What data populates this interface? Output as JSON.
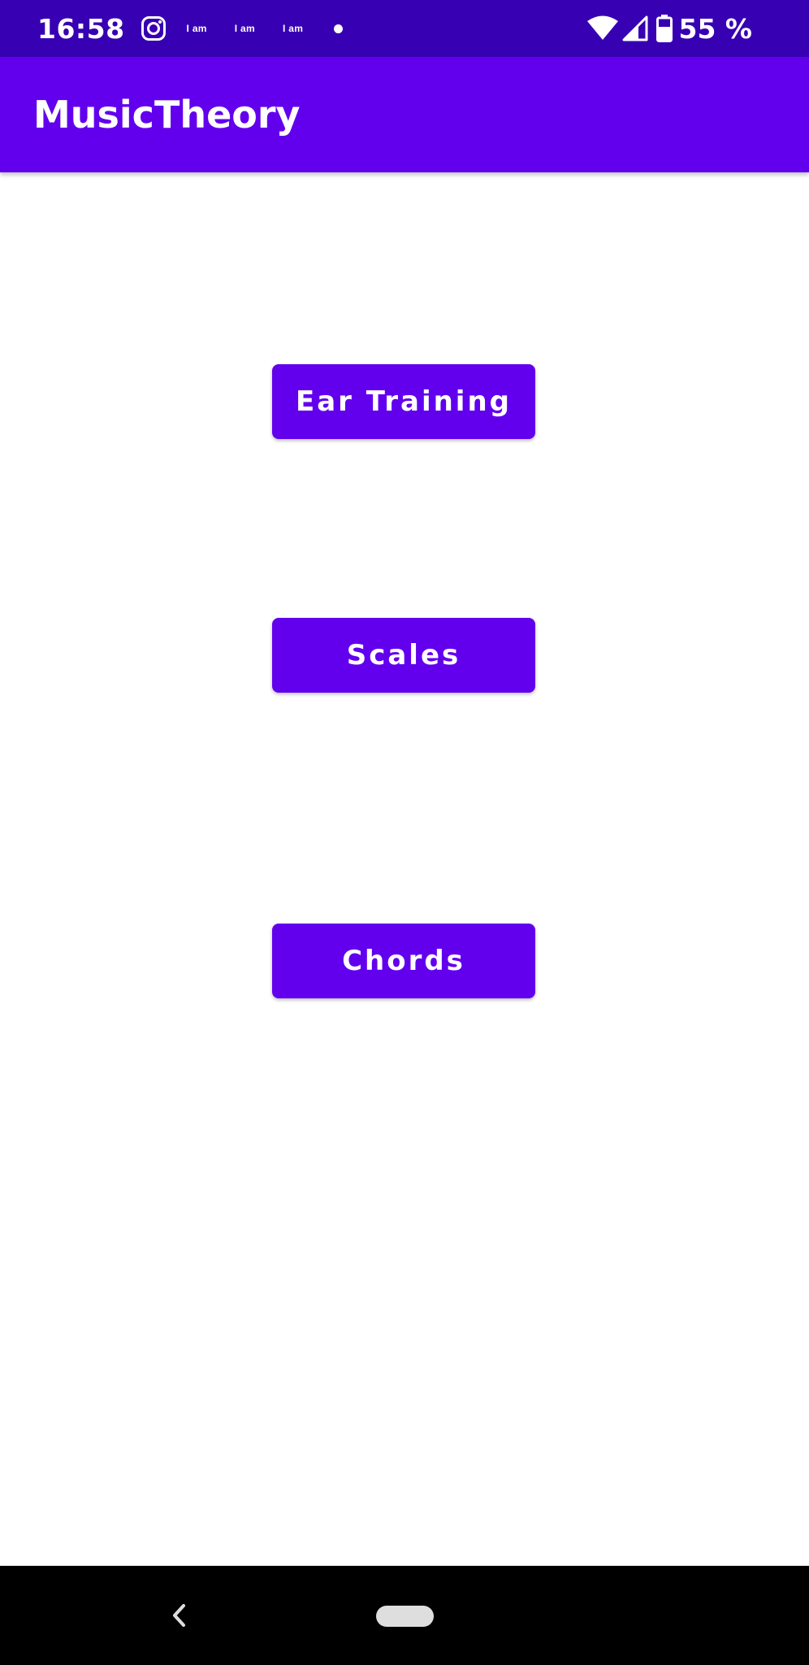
{
  "status_bar": {
    "time": "16:58",
    "notifications": [
      "I am",
      "I am",
      "I am"
    ],
    "battery_percent": "55 %",
    "icons": [
      "instagram-icon",
      "dot-icon",
      "wifi-icon",
      "signal-icon",
      "battery-icon"
    ]
  },
  "app_bar": {
    "title": "MusicTheory",
    "color": "#6200ee"
  },
  "buttons": {
    "ear_training": "Ear Training",
    "scales": "Scales",
    "chords": "Chords"
  },
  "nav_bar": {
    "icons": [
      "back-icon",
      "home-pill-icon"
    ]
  },
  "colors": {
    "status_bar": "#3700b3",
    "primary": "#6200ee",
    "background": "#ffffff",
    "nav_bar": "#000000"
  }
}
